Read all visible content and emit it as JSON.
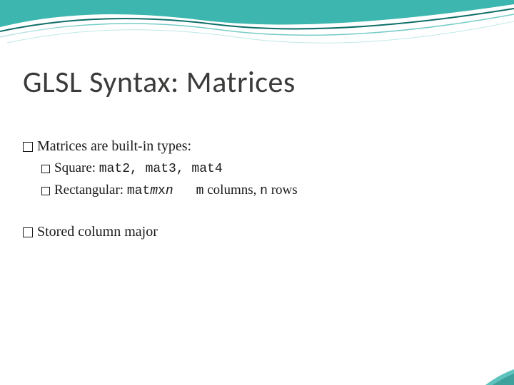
{
  "slide": {
    "title": "GLSL Syntax: Matrices",
    "bullets": {
      "b1": {
        "text": "Matrices  are built-in types:",
        "sub": {
          "s1": {
            "label": "Square: ",
            "code": "mat2, mat3, mat4"
          },
          "s2": {
            "label": "Rectangular: ",
            "code_prefix": "mat",
            "code_m": "m",
            "code_x": "x",
            "code_n": "n",
            "note_m": "m",
            "note_mid": " columns, ",
            "note_n": "n",
            "note_end": " rows"
          }
        }
      },
      "b2": {
        "text": "Stored column major"
      }
    }
  }
}
